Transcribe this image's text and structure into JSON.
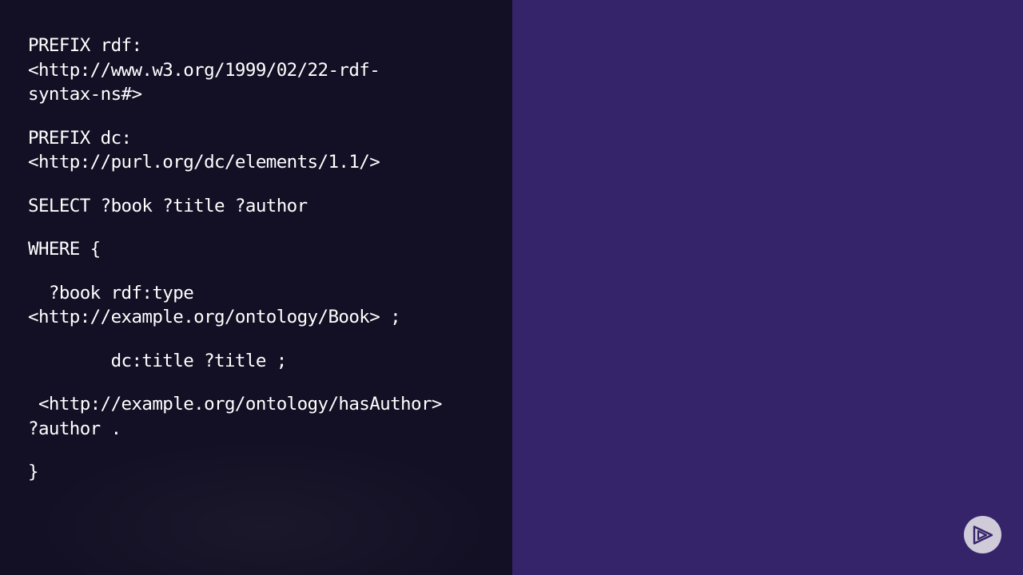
{
  "code": {
    "lines": [
      "PREFIX rdf:",
      "<http://www.w3.org/1999/02/22-rdf-",
      "syntax-ns#>",
      "",
      "PREFIX dc:",
      "<http://purl.org/dc/elements/1.1/>",
      "",
      "SELECT ?book ?title ?author",
      "",
      "WHERE {",
      "",
      "  ?book rdf:type",
      "<http://example.org/ontology/Book> ;",
      "",
      "        dc:title ?title ;",
      "",
      " <http://example.org/ontology/hasAuthor>",
      "?author .",
      "",
      "}"
    ]
  },
  "play_button": {
    "icon": "play-logo-icon"
  },
  "colors": {
    "left_background": "#130f24",
    "right_background": "#35246a",
    "code_text": "#ffffff",
    "button_fill": "#cfcbd9",
    "button_icon": "#35246a"
  }
}
